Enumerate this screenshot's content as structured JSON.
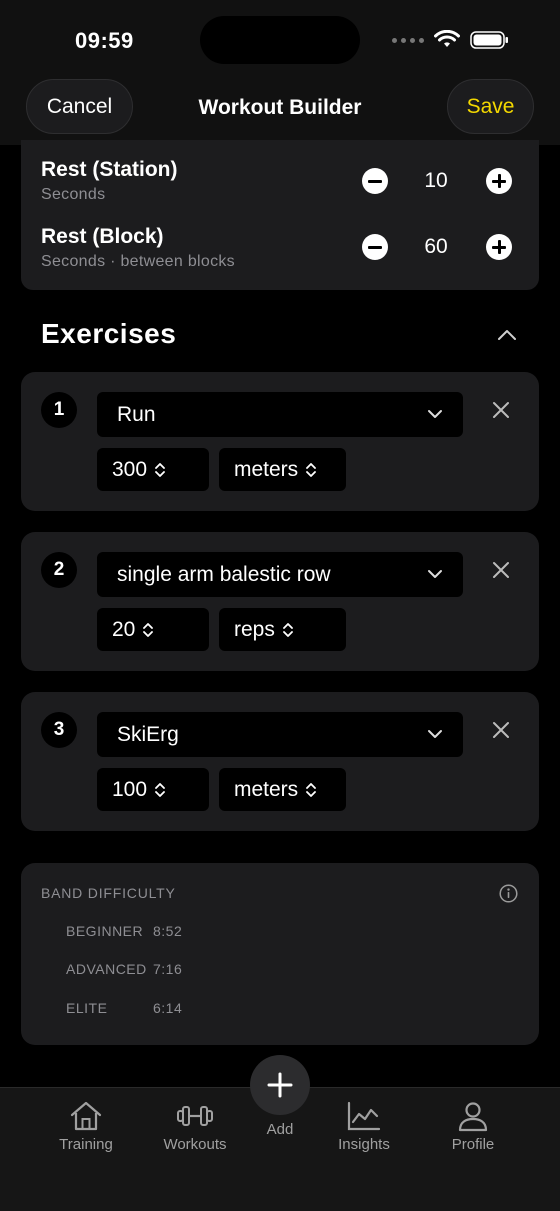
{
  "status_bar": {
    "time": "09:59"
  },
  "nav": {
    "cancel_label": "Cancel",
    "title": "Workout Builder",
    "save_label": "Save"
  },
  "rest": [
    {
      "label": "Rest (Station)",
      "sub": "Seconds",
      "value": "10"
    },
    {
      "label": "Rest (Block)",
      "sub": "Seconds · between blocks",
      "value": "60"
    }
  ],
  "exercises_title": "Exercises",
  "exercises": [
    {
      "num": "1",
      "name": "Run",
      "qty": "300",
      "unit": "meters"
    },
    {
      "num": "2",
      "name": "single arm balestic row",
      "qty": "20",
      "unit": "reps"
    },
    {
      "num": "3",
      "name": "SkiErg",
      "qty": "100",
      "unit": "meters"
    }
  ],
  "band": {
    "title": "BAND DIFFICULTY",
    "rows": [
      {
        "level": "BEGINNER",
        "time": "8:52"
      },
      {
        "level": "ADVANCED",
        "time": "7:16"
      },
      {
        "level": "ELITE",
        "time": "6:14"
      }
    ]
  },
  "tabs": {
    "training": "Training",
    "workouts": "Workouts",
    "add": "Add",
    "insights": "Insights",
    "profile": "Profile"
  },
  "colors": {
    "accent": "#f4d800",
    "card": "#1c1c1e",
    "background": "#000000"
  },
  "icons": [
    "wifi-icon",
    "battery-icon",
    "minus-icon",
    "plus-icon",
    "chevron-up-icon",
    "chevron-down-icon",
    "close-icon",
    "stepper-icon",
    "info-icon",
    "home-icon",
    "dumbbell-icon",
    "add-icon",
    "chart-icon",
    "person-icon"
  ]
}
